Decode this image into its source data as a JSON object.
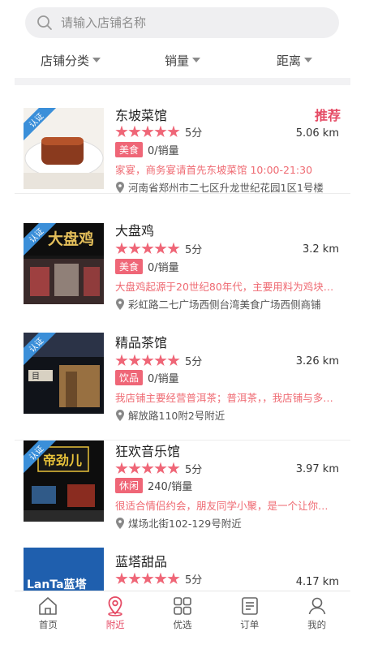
{
  "search": {
    "placeholder": "请输入店铺名称"
  },
  "filters": [
    "店铺分类",
    "销量",
    "距离"
  ],
  "stores": [
    {
      "name": "东坡菜馆",
      "badge": "推荐",
      "rating": 5,
      "score_label": "5分",
      "distance": "5.06 km",
      "category": "美食",
      "sales": "0/销量",
      "desc": "家宴，商务宴请首先东坡菜馆 10:00-21:30",
      "address": "河南省郑州市二七区升龙世纪花园1区1号楼",
      "certified_label": "认证",
      "thumb_colors": [
        "#ffffff",
        "#8a3a1e"
      ]
    },
    {
      "name": "大盘鸡",
      "badge": "",
      "rating": 5,
      "score_label": "5分",
      "distance": "3.2 km",
      "category": "美食",
      "sales": "0/销量",
      "desc": "大盘鸡起源于20世纪80年代，主要用料为鸡块…",
      "address": "彩虹路二七广场西侧台湾美食广场西侧商铺",
      "certified_label": "认证",
      "thumb_colors": [
        "#1a1a1a",
        "#d9b24a"
      ]
    },
    {
      "name": "精品茶馆",
      "badge": "",
      "rating": 5,
      "score_label": "5分",
      "distance": "3.26 km",
      "category": "饮品",
      "sales": "0/销量",
      "desc": "我店铺主要经营普洱茶；普洱茶，，我店铺与多…",
      "address": "解放路110附2号附近",
      "certified_label": "认证",
      "thumb_colors": [
        "#1e2330",
        "#c89a5a"
      ]
    },
    {
      "name": "狂欢音乐馆",
      "badge": "",
      "rating": 5,
      "score_label": "5分",
      "distance": "3.97 km",
      "category": "休闲",
      "sales": "240/销量",
      "desc": "很适合情侣约会，朋友同学小聚，是一个让你…",
      "address": "煤场北街102-129号附近",
      "certified_label": "认证",
      "thumb_colors": [
        "#101010",
        "#e8c23a"
      ]
    },
    {
      "name": "蓝塔甜品",
      "badge": "",
      "rating": 5,
      "score_label": "5分",
      "distance": "4.17 km",
      "category": "",
      "sales": "",
      "desc": "",
      "address": "",
      "certified_label": "",
      "thumb_colors": [
        "#1f5fae",
        "#ffffff"
      ]
    }
  ],
  "thumb_text": {
    "dapanji": "大盘鸡",
    "tea": "目",
    "music": "帝劲儿",
    "lanta": "LanTa蓝塔"
  },
  "tabs": [
    {
      "label": "首页",
      "icon": "home-icon",
      "active": false
    },
    {
      "label": "附近",
      "icon": "location-icon",
      "active": true
    },
    {
      "label": "优选",
      "icon": "grid-icon",
      "active": false
    },
    {
      "label": "订单",
      "icon": "order-icon",
      "active": false
    },
    {
      "label": "我的",
      "icon": "user-icon",
      "active": false
    }
  ],
  "colors": {
    "accent": "#e54a64",
    "star": "#ef6677",
    "ribbon": "#3b8fd9"
  }
}
